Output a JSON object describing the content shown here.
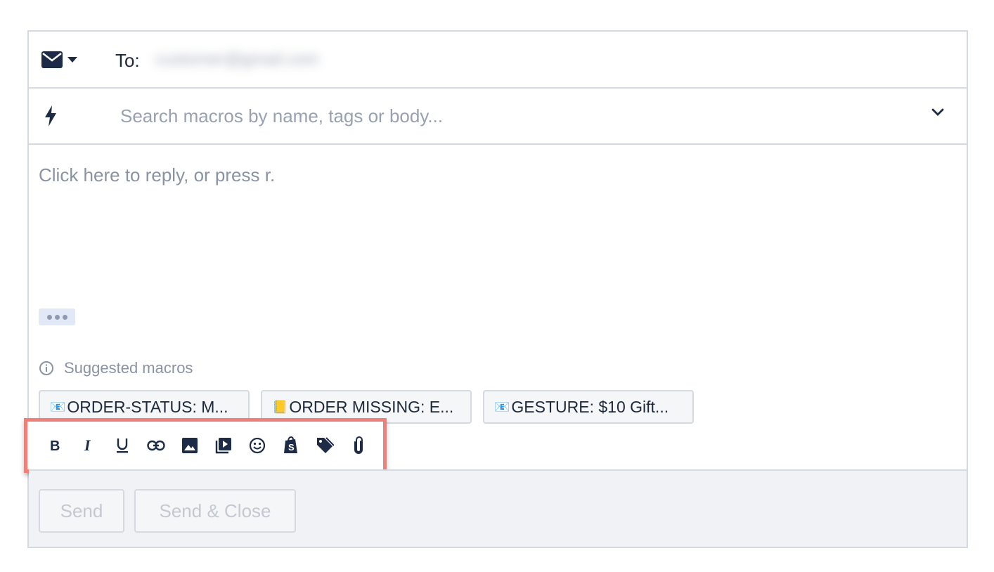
{
  "header": {
    "to_label": "To:",
    "to_value": "customer@gmail.com",
    "channel_icon": "mail-icon"
  },
  "macro_search": {
    "placeholder": "Search macros by name, tags or body..."
  },
  "reply": {
    "placeholder": "Click here to reply, or press r."
  },
  "suggested": {
    "label": "Suggested macros",
    "chips": [
      {
        "emoji": "📧",
        "label": "ORDER-STATUS: M..."
      },
      {
        "emoji": "📒",
        "label": "ORDER MISSING: E..."
      },
      {
        "emoji": "📧",
        "label": "GESTURE: $10 Gift..."
      }
    ]
  },
  "toolbar": {
    "tools": [
      "bold-icon",
      "italic-icon",
      "underline-icon",
      "link-icon",
      "image-icon",
      "video-icon",
      "emoji-icon",
      "shopify-icon",
      "tag-icon",
      "attachment-icon"
    ]
  },
  "footer": {
    "send_label": "Send",
    "send_close_label": "Send & Close"
  },
  "colors": {
    "highlight": "#ef7f79",
    "border": "#d5d9e0",
    "footer_bg": "#f1f2f6",
    "icon_dark": "#1d2b47"
  }
}
